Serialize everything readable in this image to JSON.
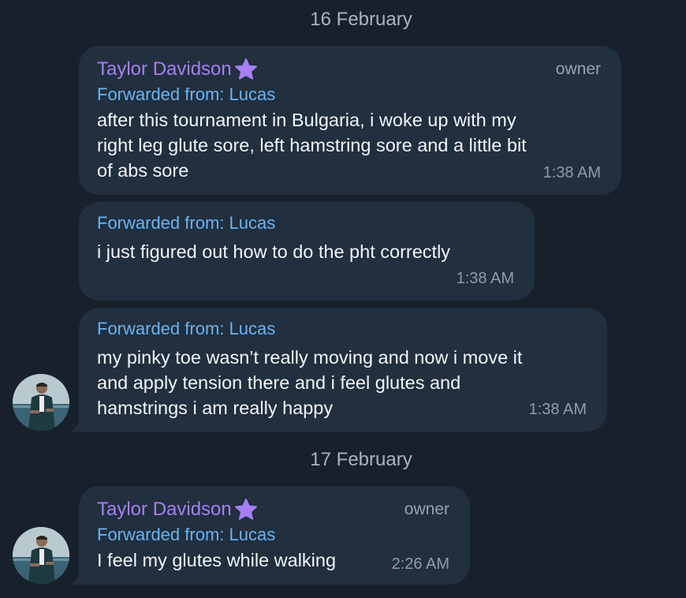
{
  "dates": [
    "16 February",
    "17 February"
  ],
  "messages": [
    {
      "sender": "Taylor Davidson",
      "role": "owner",
      "forwarded": "Forwarded from: Lucas",
      "lines": [
        "after this tournament in Bulgaria, i woke up with my",
        "right leg glute sore, left hamstring sore and a little bit",
        "of abs sore"
      ],
      "time": "1:38 AM"
    },
    {
      "forwarded": "Forwarded from: Lucas",
      "lines": [
        "i just figured out how to do the pht correctly"
      ],
      "time": "1:38 AM"
    },
    {
      "forwarded": "Forwarded from: Lucas",
      "lines": [
        "my pinky toe wasn’t really moving and now i move it",
        "and apply tension there and i feel glutes and",
        "hamstrings i am really happy"
      ],
      "time": "1:38 AM"
    },
    {
      "sender": "Taylor Davidson",
      "role": "owner",
      "forwarded": "Forwarded from: Lucas",
      "lines": [
        "I feel my glutes while walking"
      ],
      "time": "2:26 AM"
    }
  ],
  "icons": {
    "sender_badge": "star-icon",
    "avatar": "user-avatar"
  },
  "colors": {
    "background": "#18212b",
    "bubble": "#212f3e",
    "sender": "#a77ff2",
    "forwarded": "#6ab3f3",
    "text": "#f2f5f8",
    "meta": "#8f9dab"
  }
}
